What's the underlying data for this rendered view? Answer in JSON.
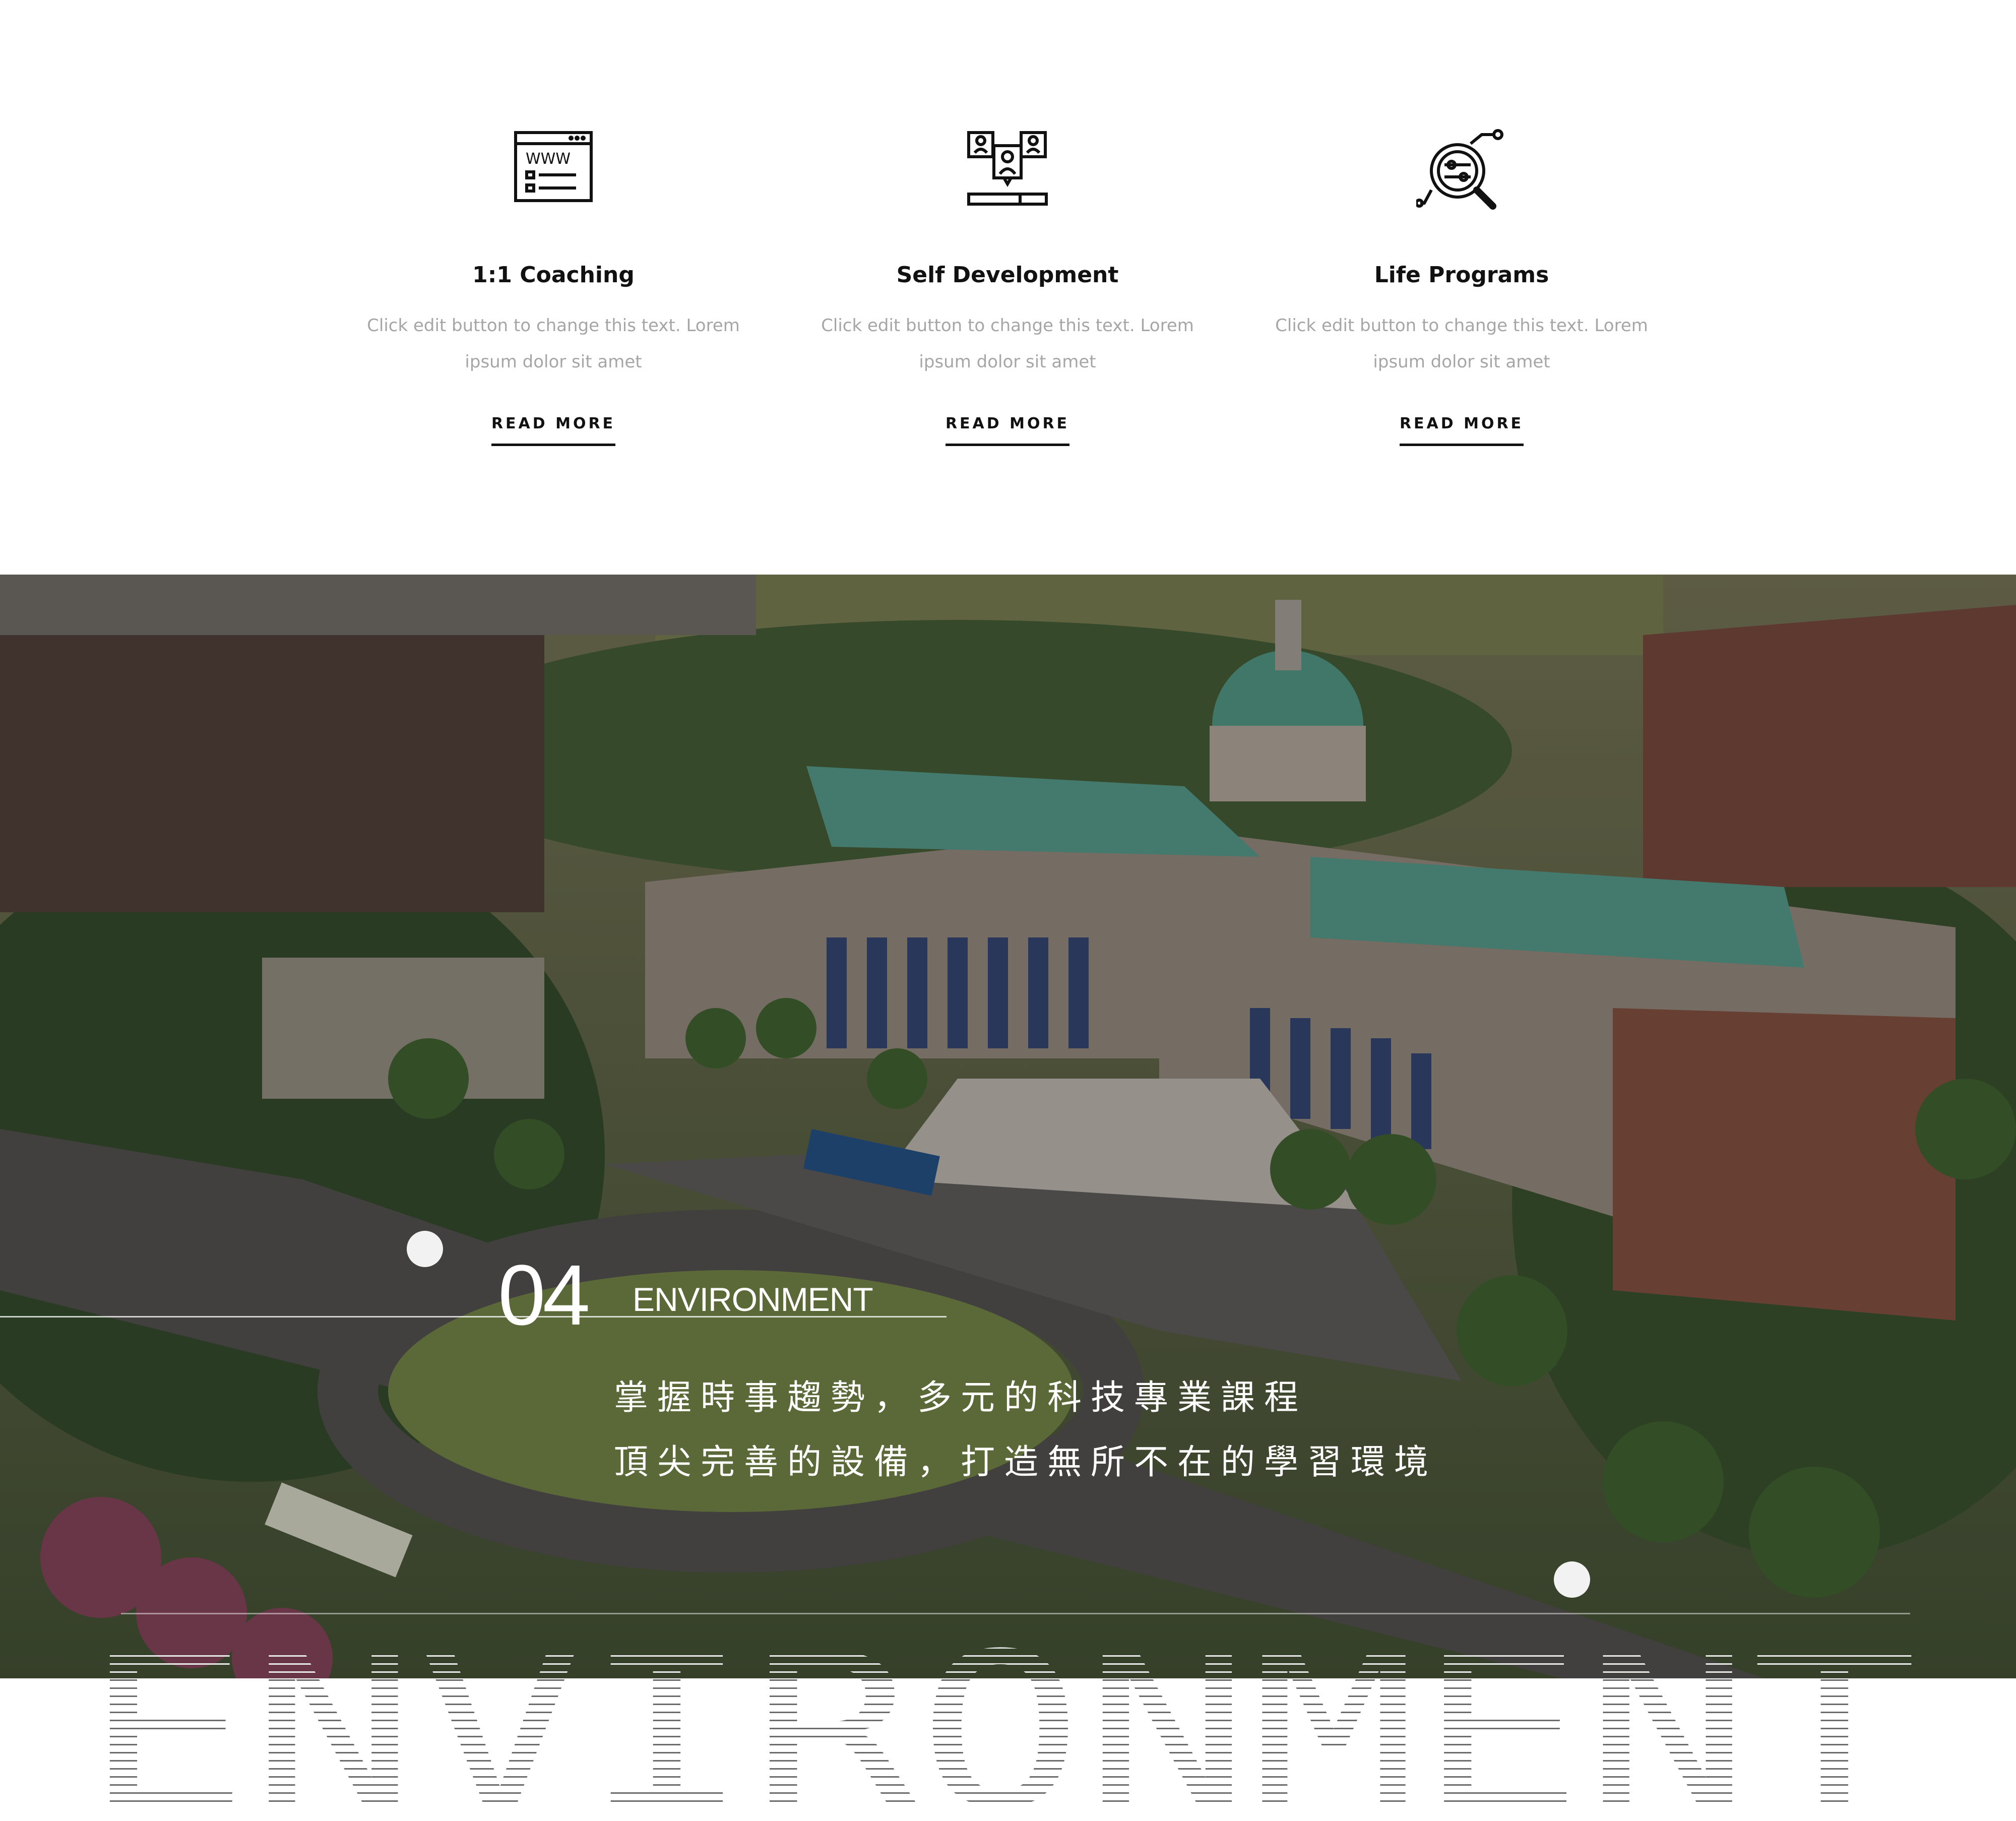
{
  "features": [
    {
      "title": "1:1 Coaching",
      "desc": "Click edit button to change this text. Lorem ipsum dolor sit amet",
      "more": "READ MORE",
      "icon": "website-icon"
    },
    {
      "title": "Self Development",
      "desc": "Click edit button to change this text. Lorem ipsum dolor sit amet",
      "more": "READ MORE",
      "icon": "people-presentation-icon"
    },
    {
      "title": "Life Programs",
      "desc": "Click edit button to change this text. Lorem ipsum dolor sit amet",
      "more": "READ MORE",
      "icon": "search-analysis-icon"
    }
  ],
  "hero": {
    "number": "04",
    "label": "ENVIRONMENT",
    "line1": "掌握時事趨勢，多元的科技專業課程",
    "line2": "頂尖完善的設備，打造無所不在的學習環境",
    "image": "aerial-campus-photo"
  },
  "bigword": "ENVIRONMENT"
}
